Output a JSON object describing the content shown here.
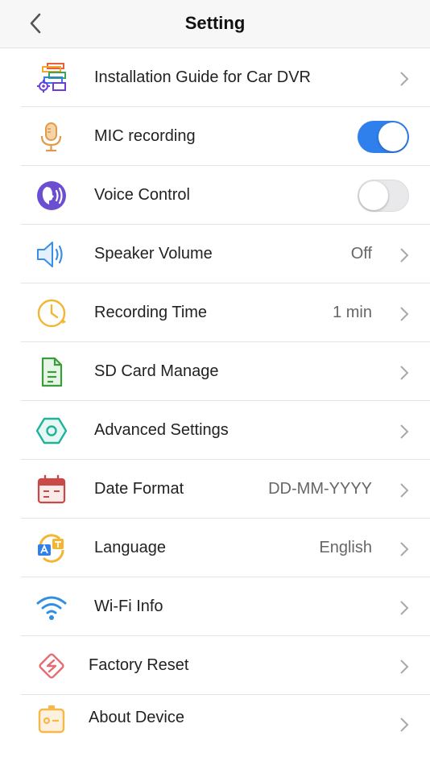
{
  "header": {
    "title": "Setting",
    "back_icon": "chevron-left-icon"
  },
  "items": [
    {
      "label": "Installation Guide for Car DVR",
      "icon": "installation-guide-icon",
      "type": "link"
    },
    {
      "label": "MIC recording",
      "icon": "microphone-icon",
      "type": "toggle",
      "on": true
    },
    {
      "label": "Voice Control",
      "icon": "voice-control-icon",
      "type": "toggle",
      "on": false
    },
    {
      "label": "Speaker Volume",
      "icon": "speaker-icon",
      "type": "link",
      "value": "Off"
    },
    {
      "label": "Recording Time",
      "icon": "clock-icon",
      "type": "link",
      "value": "1 min"
    },
    {
      "label": "SD Card Manage",
      "icon": "sd-card-icon",
      "type": "link"
    },
    {
      "label": "Advanced Settings",
      "icon": "hexagon-settings-icon",
      "type": "link"
    },
    {
      "label": "Date Format",
      "icon": "calendar-icon",
      "type": "link",
      "value": "DD-MM-YYYY"
    },
    {
      "label": "Language",
      "icon": "language-icon",
      "type": "link",
      "value": "English"
    },
    {
      "label": "Wi-Fi Info",
      "icon": "wifi-icon",
      "type": "link"
    },
    {
      "label": "Factory Reset",
      "icon": "factory-reset-icon",
      "type": "link"
    },
    {
      "label": "About Device",
      "icon": "device-info-icon",
      "type": "link"
    }
  ],
  "colors": {
    "accent": "#2f80ed",
    "header_bg": "#f7f7f7",
    "separator": "#e4e4e4",
    "chevron": "#a8a8a8"
  }
}
